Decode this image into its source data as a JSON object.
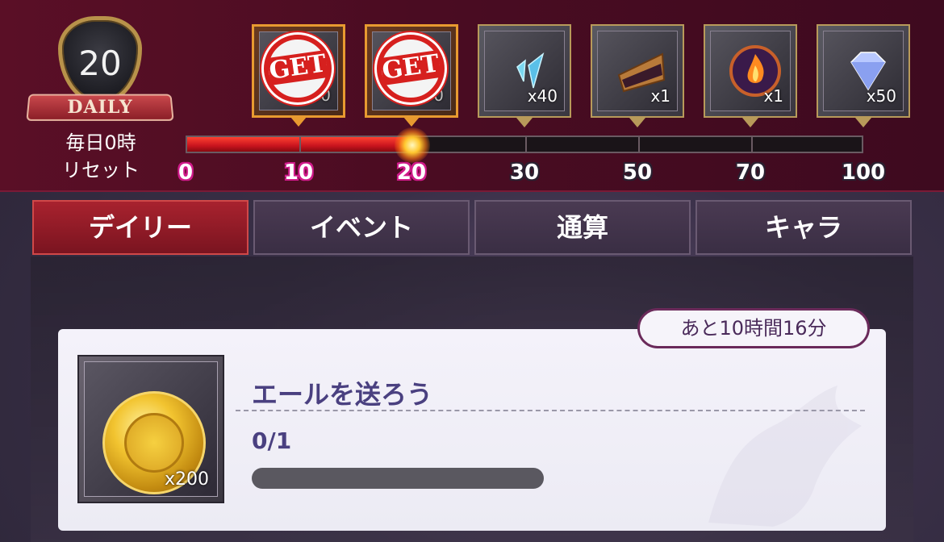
{
  "daily_badge": {
    "level": "20",
    "ribbon": "DAILY",
    "reset_line1": "毎日0時",
    "reset_line2": "リセット"
  },
  "rewards": [
    {
      "count": "x300",
      "state": "claimed",
      "stamp": "GET",
      "icon": "bread-icon"
    },
    {
      "count": "x400",
      "state": "claimed",
      "stamp": "GET",
      "icon": "bread-icon"
    },
    {
      "count": "x40",
      "state": "locked",
      "icon": "crystal-shards-icon"
    },
    {
      "count": "x1",
      "state": "locked",
      "icon": "pie-slice-icon"
    },
    {
      "count": "x1",
      "state": "locked",
      "icon": "flame-orb-icon"
    },
    {
      "count": "x50",
      "state": "locked",
      "icon": "diamond-icon"
    }
  ],
  "progress": {
    "current": 20,
    "max": 100,
    "milestones": [
      "0",
      "10",
      "20",
      "30",
      "50",
      "70",
      "100"
    ]
  },
  "tabs": [
    {
      "label": "デイリー",
      "active": true
    },
    {
      "label": "イベント",
      "active": false
    },
    {
      "label": "通算",
      "active": false
    },
    {
      "label": "キャラ",
      "active": false
    }
  ],
  "timer": "あと10時間16分",
  "task": {
    "title": "エールを送ろう",
    "progress_text": "0/1",
    "progress_current": 0,
    "progress_total": 1,
    "reward_count": "x200",
    "reward_icon": "gold-coin-icon"
  },
  "colors": {
    "accent_red": "#c8141e",
    "milestone_reached": "#d01a8a",
    "banner_bg": "#4a0c22",
    "task_title": "#4a4080"
  }
}
